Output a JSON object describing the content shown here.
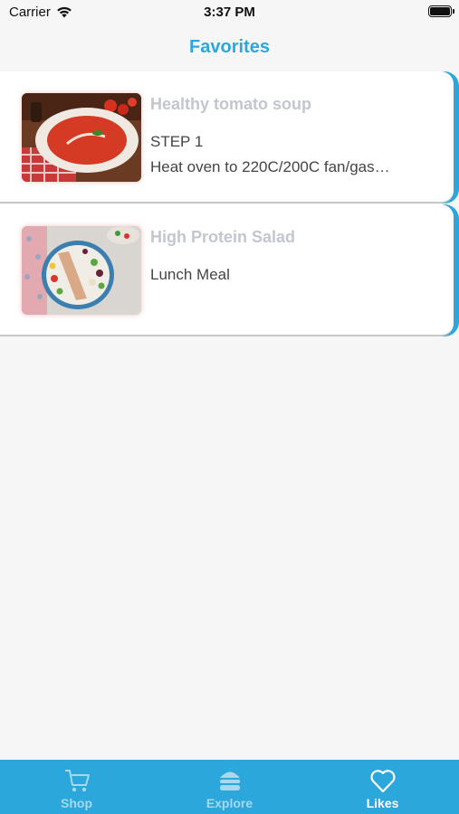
{
  "status_bar": {
    "carrier": "Carrier",
    "time": "3:37 PM"
  },
  "header": {
    "title": "Favorites"
  },
  "favorites": [
    {
      "title": "Healthy tomato soup",
      "line1": "STEP 1",
      "line2": "Heat oven to 220C/200C fan/gas…",
      "image": "tomato-soup-photo"
    },
    {
      "title": "High Protein Salad",
      "line1": "Lunch Meal",
      "line2": "",
      "image": "protein-salad-photo"
    }
  ],
  "tab_bar": {
    "tabs": [
      {
        "label": "Shop",
        "icon": "cart-icon",
        "active": false
      },
      {
        "label": "Explore",
        "icon": "burger-icon",
        "active": false
      },
      {
        "label": "Likes",
        "icon": "heart-icon",
        "active": true
      }
    ]
  },
  "colors": {
    "accent": "#2ca7dc",
    "title_muted": "#c3c6cf",
    "background": "#f6f6f6"
  }
}
